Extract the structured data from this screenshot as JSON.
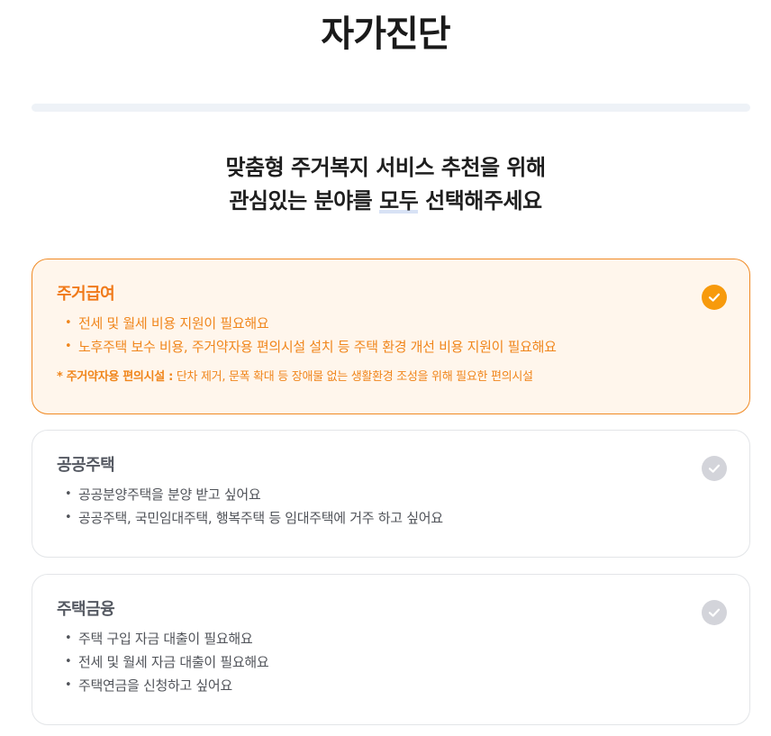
{
  "page": {
    "title": "자가진단",
    "progress": 0,
    "question_line1": "맞춤형 주거복지 서비스 추천을 위해",
    "question_line2_pre": "관심있는 분야를 ",
    "question_line2_highlight": "모두",
    "question_line2_post": " 선택해주세요"
  },
  "colors": {
    "accent": "#f08a24",
    "check_selected": "#f79a0c",
    "check_unselected": "#d3d4da",
    "selected_background": "#fff6ec"
  },
  "options": [
    {
      "title": "주거급여",
      "selected": true,
      "icon": "check-circle-icon",
      "items": [
        "전세 및 월세 비용 지원이 필요해요",
        "노후주택 보수 비용, 주거약자용 편의시설 설치 등 주택 환경 개선 비용 지원이 필요해요"
      ],
      "note_label": "* 주거약자용 편의시설 :",
      "note_text": " 단차 제거, 문폭 확대 등 장애물 없는 생활환경 조성을 위해 필요한 편의시설"
    },
    {
      "title": "공공주택",
      "selected": false,
      "icon": "check-circle-icon",
      "items": [
        "공공분양주택을 분양 받고 싶어요",
        "공공주택, 국민임대주택, 행복주택 등 임대주택에 거주 하고 싶어요"
      ]
    },
    {
      "title": "주택금융",
      "selected": false,
      "icon": "check-circle-icon",
      "items": [
        "주택 구입 자금 대출이 필요해요",
        "전세 및 월세 자금 대출이 필요해요",
        "주택연금을 신청하고 싶어요"
      ]
    }
  ]
}
